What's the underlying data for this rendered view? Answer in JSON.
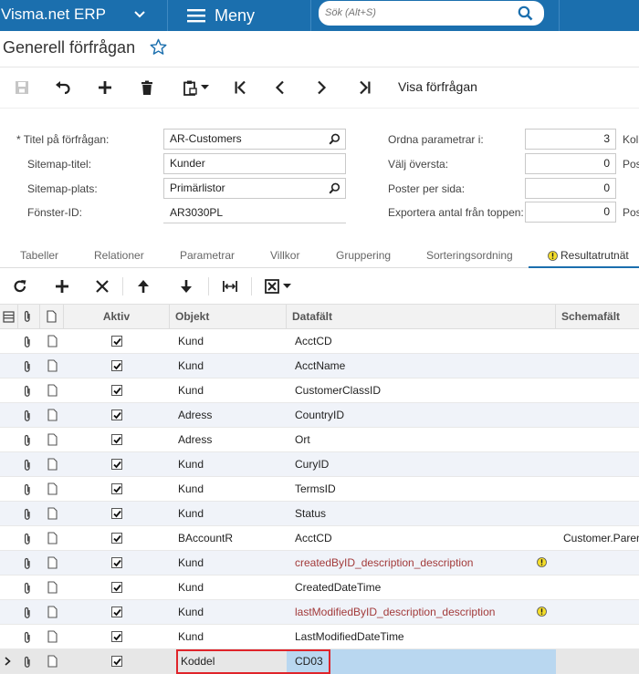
{
  "topbar": {
    "brand": "Visma.net ERP",
    "menu_label": "Meny",
    "search_placeholder": "Sök (Alt+S)"
  },
  "page": {
    "title": "Generell förfrågan"
  },
  "toolbar": {
    "visa_label": "Visa förfrågan"
  },
  "form": {
    "left": [
      {
        "label": "* Titel på förfrågan:",
        "value": "AR-Customers"
      },
      {
        "label": "Sitemap-titel:",
        "value": "Kunder"
      },
      {
        "label": "Sitemap-plats:",
        "value": "Primärlistor"
      },
      {
        "label": "Fönster-ID:",
        "value": "AR3030PL"
      }
    ],
    "right": [
      {
        "label": "Ordna parametrar i:",
        "value": "3",
        "suffix": "Kol"
      },
      {
        "label": "Välj översta:",
        "value": "0",
        "suffix": "Pos"
      },
      {
        "label": "Poster per sida:",
        "value": "0",
        "suffix": ""
      },
      {
        "label": "Exportera antal från toppen:",
        "value": "0",
        "suffix": "Pos"
      }
    ]
  },
  "tabs": [
    "Tabeller",
    "Relationer",
    "Parametrar",
    "Villkor",
    "Gruppering",
    "Sorteringsordning",
    "Resultatrutnät"
  ],
  "grid": {
    "headers": {
      "aktiv": "Aktiv",
      "objekt": "Objekt",
      "datafalt": "Datafält",
      "schemafalt": "Schemafält"
    },
    "rows": [
      {
        "objekt": "Kund",
        "datafalt": "AcctCD",
        "schemafalt": "",
        "warn": false
      },
      {
        "objekt": "Kund",
        "datafalt": "AcctName",
        "schemafalt": "",
        "warn": false
      },
      {
        "objekt": "Kund",
        "datafalt": "CustomerClassID",
        "schemafalt": "",
        "warn": false
      },
      {
        "objekt": "Adress",
        "datafalt": "CountryID",
        "schemafalt": "",
        "warn": false
      },
      {
        "objekt": "Adress",
        "datafalt": "Ort",
        "schemafalt": "",
        "warn": false
      },
      {
        "objekt": "Kund",
        "datafalt": "CuryID",
        "schemafalt": "",
        "warn": false
      },
      {
        "objekt": "Kund",
        "datafalt": "TermsID",
        "schemafalt": "",
        "warn": false
      },
      {
        "objekt": "Kund",
        "datafalt": "Status",
        "schemafalt": "",
        "warn": false
      },
      {
        "objekt": "BAccountR",
        "datafalt": "AcctCD",
        "schemafalt": "Customer.Paren",
        "warn": false
      },
      {
        "objekt": "Kund",
        "datafalt": "createdByID_description_description",
        "schemafalt": "",
        "warn": true
      },
      {
        "objekt": "Kund",
        "datafalt": "CreatedDateTime",
        "schemafalt": "",
        "warn": false
      },
      {
        "objekt": "Kund",
        "datafalt": "lastModifiedByID_description_description",
        "schemafalt": "",
        "warn": true
      },
      {
        "objekt": "Kund",
        "datafalt": "LastModifiedDateTime",
        "schemafalt": "",
        "warn": false
      },
      {
        "objekt": "Koddel",
        "datafalt": "CD03",
        "schemafalt": "",
        "warn": false
      }
    ]
  },
  "colors": {
    "brand": "#1b6fae",
    "warn_text": "#a23a3a",
    "highlight_border": "#e0242a",
    "selected_cell": "#b9d7f0"
  }
}
